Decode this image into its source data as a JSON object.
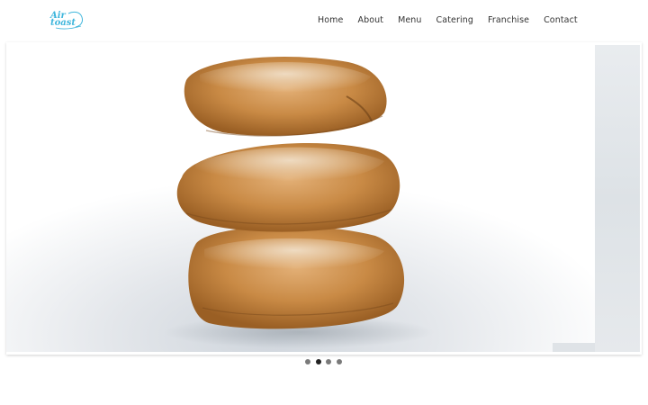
{
  "brand": {
    "logo_text": "Air\ntoast",
    "color": "#3fb6dc"
  },
  "nav": {
    "items": [
      {
        "label": "Home"
      },
      {
        "label": "About"
      },
      {
        "label": "Menu"
      },
      {
        "label": "Catering"
      },
      {
        "label": "Franchise"
      },
      {
        "label": "Contact"
      }
    ]
  },
  "slider": {
    "current_slide": 2,
    "total_slides": 4,
    "image": "stacked-ciabatta-bread"
  },
  "colors": {
    "dot_active": "#222222",
    "dot_inactive": "#7a7a7a",
    "text": "#333333"
  }
}
